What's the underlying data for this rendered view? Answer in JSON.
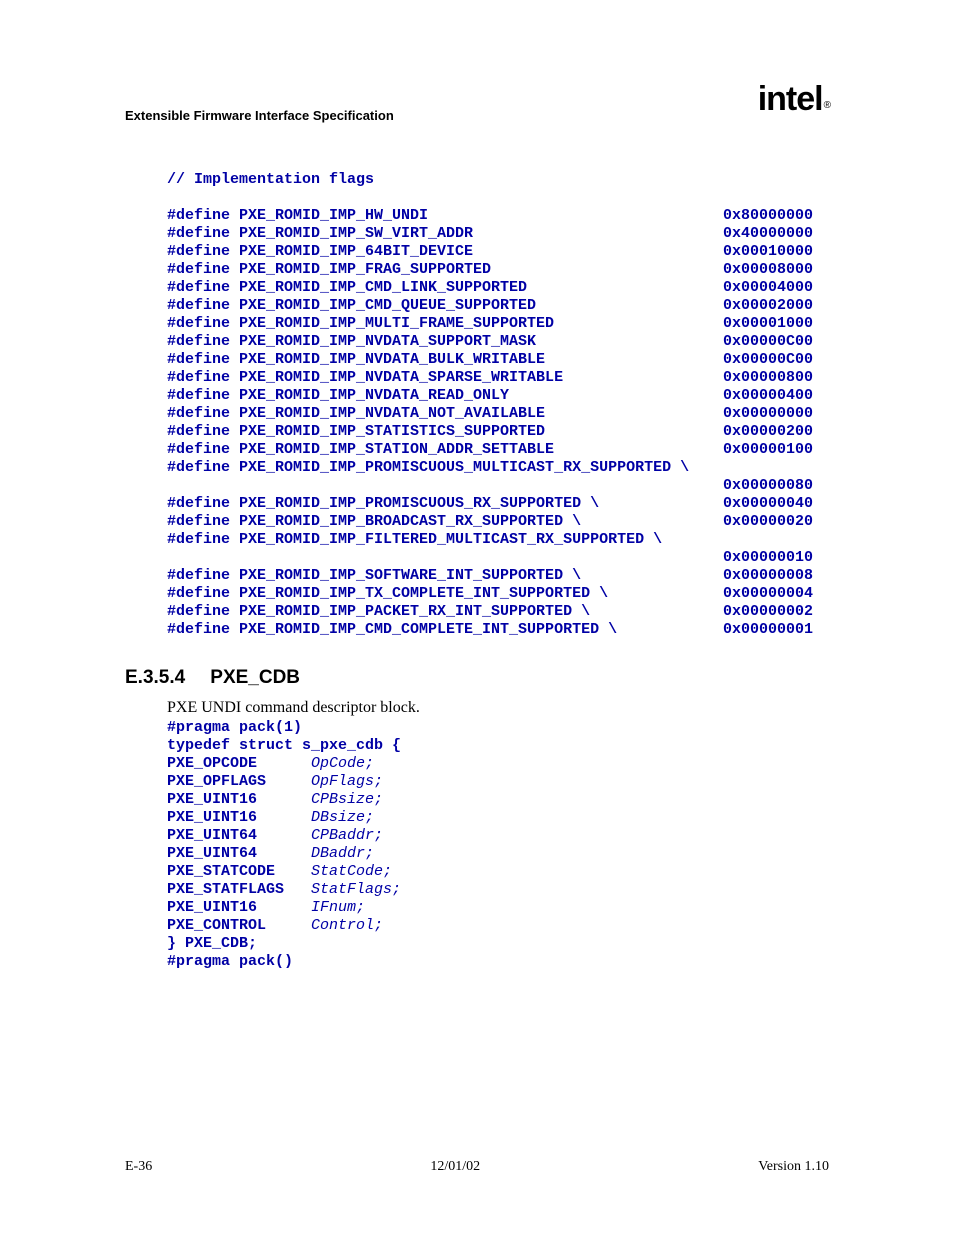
{
  "header": {
    "title": "Extensible Firmware Interface Specification",
    "logo_text": "intel",
    "logo_sub": "®"
  },
  "code_comment": "// Implementation flags",
  "defines": [
    {
      "name": "#define PXE_ROMID_IMP_HW_UNDI",
      "val": "0x80000000"
    },
    {
      "name": "#define PXE_ROMID_IMP_SW_VIRT_ADDR",
      "val": "0x40000000"
    },
    {
      "name": "#define PXE_ROMID_IMP_64BIT_DEVICE",
      "val": "0x00010000"
    },
    {
      "name": "#define PXE_ROMID_IMP_FRAG_SUPPORTED",
      "val": "0x00008000"
    },
    {
      "name": "#define PXE_ROMID_IMP_CMD_LINK_SUPPORTED",
      "val": "0x00004000"
    },
    {
      "name": "#define PXE_ROMID_IMP_CMD_QUEUE_SUPPORTED",
      "val": "0x00002000"
    },
    {
      "name": "#define PXE_ROMID_IMP_MULTI_FRAME_SUPPORTED",
      "val": "0x00001000"
    },
    {
      "name": "#define PXE_ROMID_IMP_NVDATA_SUPPORT_MASK",
      "val": "0x00000C00"
    },
    {
      "name": "#define PXE_ROMID_IMP_NVDATA_BULK_WRITABLE",
      "val": "0x00000C00"
    },
    {
      "name": "#define PXE_ROMID_IMP_NVDATA_SPARSE_WRITABLE",
      "val": "0x00000800"
    },
    {
      "name": "#define PXE_ROMID_IMP_NVDATA_READ_ONLY",
      "val": "0x00000400"
    },
    {
      "name": "#define PXE_ROMID_IMP_NVDATA_NOT_AVAILABLE",
      "val": "0x00000000"
    },
    {
      "name": "#define PXE_ROMID_IMP_STATISTICS_SUPPORTED",
      "val": "0x00000200"
    },
    {
      "name": "#define PXE_ROMID_IMP_STATION_ADDR_SETTABLE",
      "val": "0x00000100"
    },
    {
      "name": "#define PXE_ROMID_IMP_PROMISCUOUS_MULTICAST_RX_SUPPORTED \\",
      "val": ""
    },
    {
      "name": "",
      "val": "0x00000080"
    },
    {
      "name": "#define PXE_ROMID_IMP_PROMISCUOUS_RX_SUPPORTED \\",
      "val": "0x00000040"
    },
    {
      "name": "#define PXE_ROMID_IMP_BROADCAST_RX_SUPPORTED \\",
      "val": "0x00000020"
    },
    {
      "name": "#define PXE_ROMID_IMP_FILTERED_MULTICAST_RX_SUPPORTED \\",
      "val": ""
    },
    {
      "name": "",
      "val": "0x00000010"
    },
    {
      "name": "#define PXE_ROMID_IMP_SOFTWARE_INT_SUPPORTED \\",
      "val": "0x00000008"
    },
    {
      "name": "#define PXE_ROMID_IMP_TX_COMPLETE_INT_SUPPORTED \\",
      "val": "0x00000004"
    },
    {
      "name": "#define PXE_ROMID_IMP_PACKET_RX_INT_SUPPORTED \\",
      "val": "0x00000002"
    },
    {
      "name": "#define PXE_ROMID_IMP_CMD_COMPLETE_INT_SUPPORTED \\",
      "val": "0x00000001"
    }
  ],
  "section": {
    "num": "E.3.5.4",
    "title": "PXE_CDB",
    "body": "PXE UNDI command descriptor block."
  },
  "struct_pre1": "#pragma pack(1)",
  "struct_pre2": "typedef struct s_pxe_cdb {",
  "struct_fields": [
    {
      "type": " PXE_OPCODE",
      "field": "OpCode;"
    },
    {
      "type": " PXE_OPFLAGS",
      "field": "OpFlags;"
    },
    {
      "type": " PXE_UINT16",
      "field": "CPBsize;"
    },
    {
      "type": " PXE_UINT16",
      "field": "DBsize;"
    },
    {
      "type": " PXE_UINT64",
      "field": "CPBaddr;"
    },
    {
      "type": " PXE_UINT64",
      "field": "DBaddr;"
    },
    {
      "type": " PXE_STATCODE",
      "field": "StatCode;"
    },
    {
      "type": " PXE_STATFLAGS",
      "field": "StatFlags;"
    },
    {
      "type": " PXE_UINT16",
      "field": "IFnum;"
    },
    {
      "type": " PXE_CONTROL",
      "field": "Control;"
    }
  ],
  "struct_post1": "} PXE_CDB;",
  "struct_post2": "#pragma pack()",
  "footer": {
    "left": "E-36",
    "center": "12/01/02",
    "right": "Version 1.10"
  }
}
